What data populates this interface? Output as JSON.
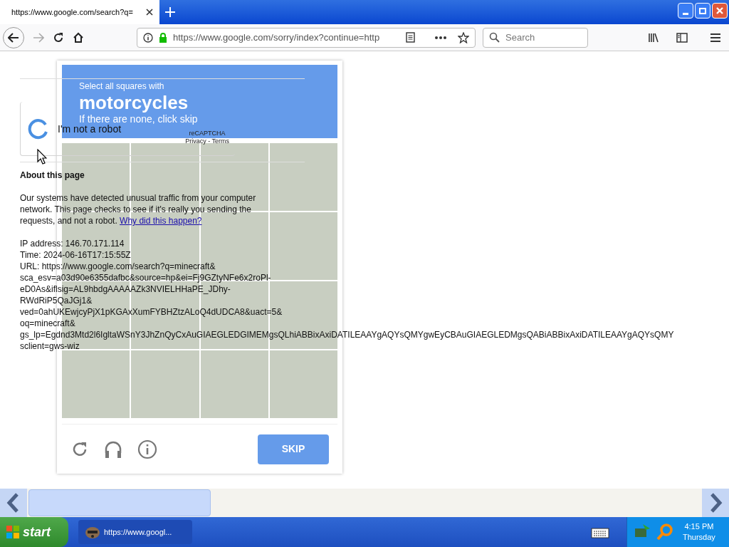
{
  "browser": {
    "tab": {
      "title": "https://www.google.com/search?q=",
      "selected": true
    },
    "address": "https://www.google.com/sorry/index?continue=http",
    "search_placeholder": "Search"
  },
  "page": {
    "checkbox_label": "I'm not a robot",
    "recaptcha_brand": "reCAPTCHA",
    "recaptcha_links": "Privacy - Terms",
    "heading": "About this page",
    "message": "Our systems have detected unusual traffic from your computer network. This page checks to see if it's really you sending the requests, and not a robot.",
    "message_link": "Why did this happen?",
    "details": [
      "IP address: 146.70.171.114",
      "Time: 2024-06-16T17:15:55Z",
      "URL: https://www.google.com/search?q=minecraft&",
      "sca_esv=a03d90e6355dafbc&source=hp&ei=Fj9GZtyNFe6x2roPl-",
      "eD0As&iflsig=AL9hbdgAAAAAZk3NVIELHHaPE_JDhy-",
      "RWdRiP5QaJGj1&",
      "ved=0ahUKEwjcyPjX1pKGAxXumFYBHZtzALoQ4dUDCA8&uact=5&",
      "oq=minecraft&",
      "gs_lp=Egdnd3Mtd2l6IgltaWSnY3JhZnQyCxAuGIAEGLEDGIMEMgsQLhiABBixAxiDATILEAAYgAQYsQMYgwEyCBAuGIAEGLEDMgsQABiABBixAxiDATILEAAYgAQYsQMY",
      "sclient=gws-wiz"
    ]
  },
  "challenge": {
    "instruction": "Select all squares with",
    "target": "motorcycles",
    "hint": "If there are none, click skip",
    "skip_button": "SKIP"
  },
  "taskbar": {
    "start": "start",
    "window_button": "https://www.googl...",
    "clock": "4:15 PM",
    "day": "Thursday"
  }
}
